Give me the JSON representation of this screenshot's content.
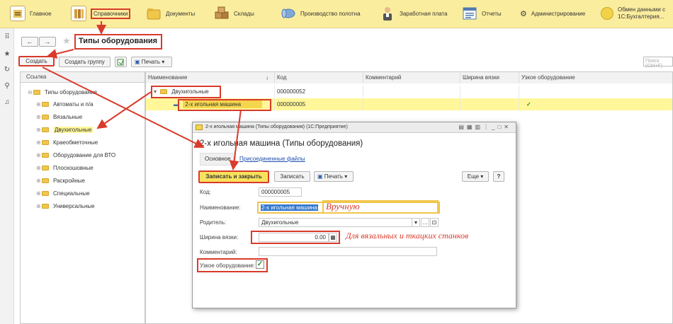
{
  "topbar": {
    "items": [
      {
        "label": "Главное",
        "icon": "home-icon"
      },
      {
        "label": "Справочники",
        "icon": "books-icon"
      },
      {
        "label": "Документы",
        "icon": "folder-icon"
      },
      {
        "label": "Склады",
        "icon": "boxes-icon"
      },
      {
        "label": "Производство полотна",
        "icon": "fabric-roll-icon"
      },
      {
        "label": "Заработная плата",
        "icon": "worker-icon"
      },
      {
        "label": "Отчеты",
        "icon": "report-icon"
      },
      {
        "label": "Администрирование",
        "icon": "gear-icon"
      },
      {
        "label": "Обмен данными с",
        "label2": "1С:Бухгалтерия...",
        "icon": "sync-icon"
      }
    ]
  },
  "page": {
    "title": "Типы оборудования",
    "nav_back": "←",
    "nav_forward": "→"
  },
  "toolbar": {
    "create": "Создать",
    "create_group": "Создать группу",
    "print": "Печать",
    "search_placeholder": "Поиск (Ctrl+F)"
  },
  "tree": {
    "header": "Ссылка",
    "root": "Типы оборудования",
    "items": [
      "Автоматы и п/а",
      "Вязальные",
      "Двухигольные",
      "Краеобметочные",
      "Оборудование для ВТО",
      "Плоскошовные",
      "Раскройные",
      "Специальные",
      "Универсальные"
    ]
  },
  "grid": {
    "columns": [
      "Наименование",
      "Код",
      "Комментарий",
      "Ширина вязки",
      "Узкое оборудование"
    ],
    "rows": [
      {
        "name": "Двухигольные",
        "code": "000000052",
        "comment": "",
        "width": "",
        "narrow": ""
      },
      {
        "name": "2-х игольная машина",
        "code": "000000005",
        "comment": "",
        "width": "",
        "narrow": "✓"
      }
    ]
  },
  "dialog": {
    "window_title": "2-х игольная машина (Типы оборудования)  (1С:Предприятие)",
    "heading": "2-х игольная машина (Типы оборудования)",
    "tab_main": "Основное",
    "tab_files": "Присоединенные файлы",
    "btn_save_close": "Записать и закрыть",
    "btn_save": "Записать",
    "btn_print": "Печать",
    "btn_more": "Еще",
    "btn_help": "?",
    "code_label": "Код:",
    "code_value": "000000005",
    "name_label": "Наименование:",
    "name_value": "2-х игольная машина",
    "parent_label": "Родитель:",
    "parent_value": "Двухигольные",
    "width_label": "Ширина вязки:",
    "width_value": "0.00",
    "comment_label": "Комментарий:",
    "comment_value": "",
    "narrow_label": "Узкое оборудование:"
  },
  "annotations": {
    "manual": "Вручную",
    "knitting_note": "Для вязальных и ткацких станков"
  },
  "colors": {
    "accent_red": "#d93a2b",
    "selection_yellow": "#fff799",
    "topbar_yellow": "#fbed9e",
    "button_yellow": "#f8e25d"
  }
}
